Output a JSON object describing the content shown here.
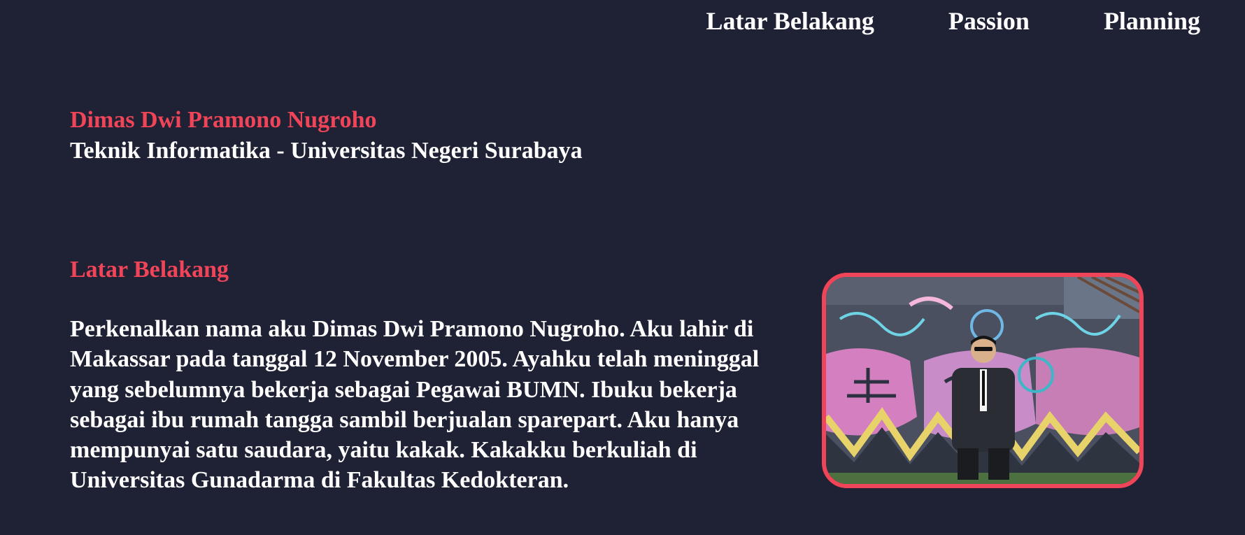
{
  "nav": {
    "items": [
      {
        "label": "Latar Belakang"
      },
      {
        "label": "Passion"
      },
      {
        "label": "Planning"
      }
    ]
  },
  "hero": {
    "name": "Dimas Dwi Pramono Nugroho",
    "subtitle": "Teknik Informatika - Universitas Negeri Surabaya"
  },
  "about": {
    "title": "Latar Belakang",
    "body": "Perkenalkan nama aku Dimas Dwi Pramono Nugroho. Aku lahir di Makassar pada tanggal 12 November 2005. Ayahku telah meninggal yang sebelumnya bekerja sebagai Pegawai BUMN. Ibuku bekerja sebagai ibu rumah tangga sambil berjualan sparepart. Aku hanya mempunyai satu saudara, yaitu kakak. Kakakku berkuliah di Universitas Gunadarma di Fakultas Kedokteran."
  },
  "colors": {
    "background": "#1f2135",
    "accent": "#f04458",
    "text": "#ffffff"
  }
}
